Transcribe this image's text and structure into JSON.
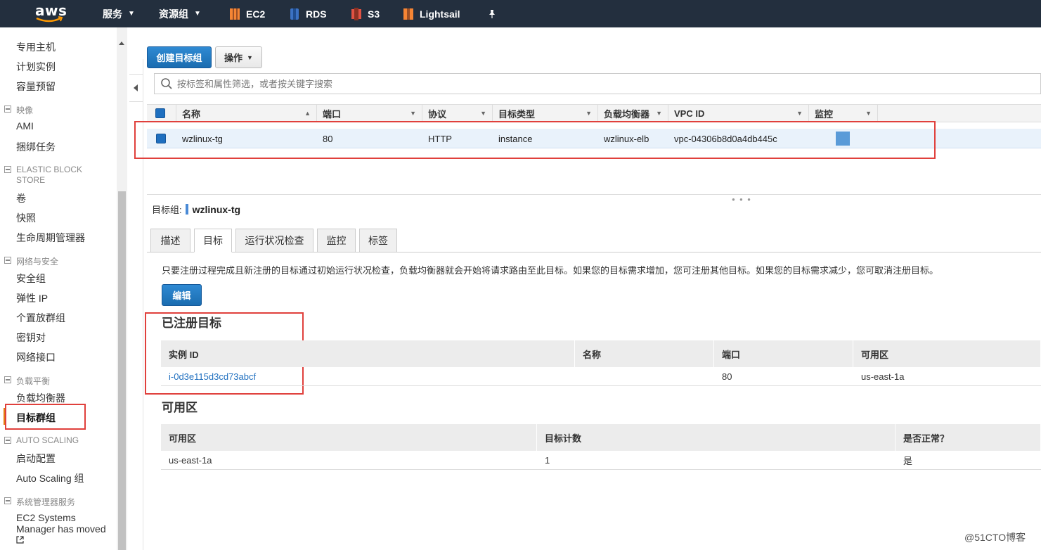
{
  "topnav": {
    "logo": "aws",
    "services": "服务",
    "resource_groups": "资源组",
    "ec2": "EC2",
    "rds": "RDS",
    "s3": "S3",
    "lightsail": "Lightsail",
    "colors": {
      "ec2": "#f58534",
      "rds": "#3b72c4",
      "s3": "#e05243",
      "lightsail": "#f58534",
      "bar": "#232f3e"
    }
  },
  "sidebar": {
    "items_top": [
      "专用主机",
      "计划实例",
      "容量预留"
    ],
    "section_images": "映像",
    "images_items": [
      "AMI",
      "捆绑任务"
    ],
    "section_ebs": "ELASTIC BLOCK STORE",
    "ebs_items": [
      "卷",
      "快照",
      "生命周期管理器"
    ],
    "section_network": "网络与安全",
    "network_items": [
      "安全组",
      "弹性 IP",
      "个置放群组",
      "密钥对",
      "网络接口"
    ],
    "section_lb": "负载平衡",
    "lb_items": [
      "负载均衡器",
      "目标群组"
    ],
    "section_autoscaling": "AUTO SCALING",
    "autoscaling_items": [
      "启动配置",
      "Auto Scaling 组"
    ],
    "section_ssm": "系统管理器服务",
    "ssm_item_line1": "EC2 Systems",
    "ssm_item_line2": "Manager has moved"
  },
  "toolbar": {
    "create_button": "创建目标组",
    "actions_button": "操作"
  },
  "search": {
    "placeholder": "按标签和属性筛选，或者按关键字搜索"
  },
  "table": {
    "columns": [
      "名称",
      "端口",
      "协议",
      "目标类型",
      "负载均衡器",
      "VPC ID",
      "监控"
    ],
    "rows": [
      {
        "name": "wzlinux-tg",
        "port": "80",
        "protocol": "HTTP",
        "target_type": "instance",
        "load_balancer": "wzlinux-elb",
        "vpc_id": "vpc-04306b8d0a4db445c"
      }
    ]
  },
  "detail": {
    "label": "目标组:",
    "name": "wzlinux-tg",
    "tabs": [
      "描述",
      "目标",
      "运行状况检查",
      "监控",
      "标签"
    ],
    "active_tab": "目标",
    "info": "只要注册过程完成且新注册的目标通过初始运行状况检查，负载均衡器就会开始将请求路由至此目标。如果您的目标需求增加，您可注册其他目标。如果您的目标需求减少，您可取消注册目标。",
    "edit_button": "编辑",
    "registered_title": "已注册目标",
    "registered_columns": [
      "实例 ID",
      "名称",
      "端口",
      "可用区"
    ],
    "registered_rows": [
      {
        "instance_id": "i-0d3e115d3cd73abcf",
        "name": "",
        "port": "80",
        "az": "us-east-1a"
      }
    ],
    "az_title": "可用区",
    "az_columns": [
      "可用区",
      "目标计数",
      "是否正常？"
    ],
    "az_rows": [
      {
        "az": "us-east-1a",
        "count": "1",
        "healthy": "是"
      }
    ]
  },
  "watermark": "@51CTO博客"
}
